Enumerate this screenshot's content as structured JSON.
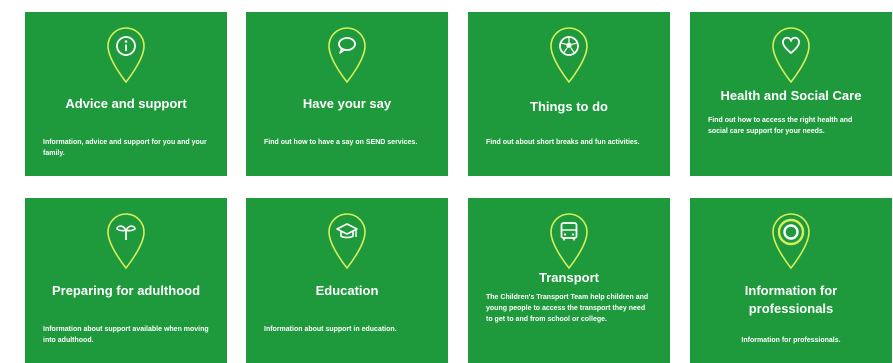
{
  "colors": {
    "tile": "#1e9a3c",
    "accent": "#d7ef5a",
    "text": "#ffffff"
  },
  "tiles": [
    {
      "title": "Advice and support",
      "description": "Information, advice and support for you and your family.",
      "icon": "info-icon"
    },
    {
      "title": "Have your say",
      "description": "Find out how to have a say on SEND services.",
      "icon": "speech-bubble-icon"
    },
    {
      "title": "Things to do",
      "description": "Find out about short breaks and fun activities.",
      "icon": "ball-icon"
    },
    {
      "title": "Health and Social Care",
      "description": "Find out how to access the right health and social care support for your needs.",
      "icon": "heart-icon"
    },
    {
      "title": "Preparing for adulthood",
      "description": "Information about support available when moving into adulthood.",
      "icon": "sprout-icon"
    },
    {
      "title": "Education",
      "description": "Information about support in education.",
      "icon": "graduation-cap-icon"
    },
    {
      "title": "Transport",
      "description": "The Children's Transport Team help children and young people to access the transport they need to get to and from school or college.",
      "icon": "bus-icon"
    },
    {
      "title": "Information for professionals",
      "description": "Information for professionals.",
      "icon": "target-icon"
    }
  ]
}
